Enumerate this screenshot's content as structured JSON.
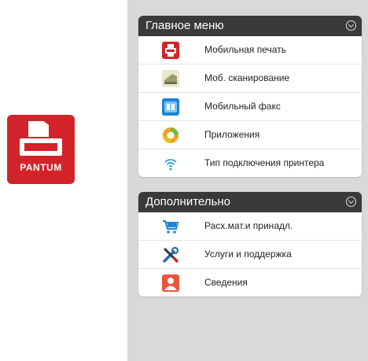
{
  "logo": {
    "brand": "PANTUM"
  },
  "main_menu": {
    "title": "Главное меню",
    "items": [
      {
        "label": "Мобильная печать",
        "icon": "printer-icon"
      },
      {
        "label": "Моб. сканирование",
        "icon": "scanner-icon"
      },
      {
        "label": "Мобильный факс",
        "icon": "fax-icon"
      },
      {
        "label": "Приложения",
        "icon": "apps-icon"
      },
      {
        "label": "Тип подключения принтера",
        "icon": "wifi-icon"
      }
    ]
  },
  "extra_menu": {
    "title": "Дополнительно",
    "items": [
      {
        "label": "Расх.мат.и принадл.",
        "icon": "cart-icon"
      },
      {
        "label": "Услуги и поддержка",
        "icon": "tools-icon"
      },
      {
        "label": "Сведения",
        "icon": "user-icon"
      }
    ]
  },
  "colors": {
    "brand_red": "#d2232a",
    "header_dark": "#3a3a3a",
    "background_gray": "#d9d9d9"
  }
}
